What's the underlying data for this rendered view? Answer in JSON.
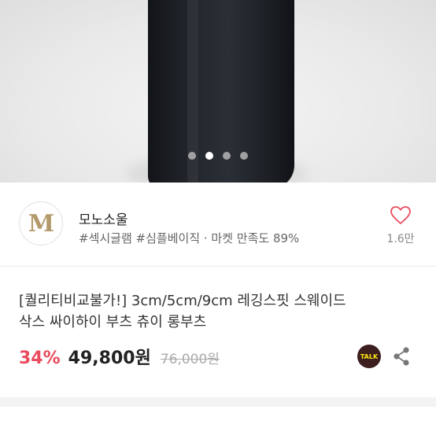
{
  "carousel": {
    "dot_count": 4,
    "active_index": 1
  },
  "store": {
    "logo_text": "M",
    "logo_color": "#b49a6b",
    "name": "모노소울",
    "tags": "#섹시글램 #심플베이직 · 마켓 만족도 89%",
    "likes": "1.6만"
  },
  "product": {
    "title_line1": "[퀄리티비교불가!] 3cm/5cm/9cm 레깅스핏 스웨이드",
    "title_line2": "삭스 싸이하이 부츠 츄이 롱부츠",
    "discount": "34%",
    "price": "49,800원",
    "original_price": "76,000원",
    "discount_color": "#e84c5e"
  },
  "actions": {
    "talk_label": "TALK",
    "talk_icon": "kakaotalk-icon",
    "share_icon": "share-icon",
    "like_icon": "heart-icon"
  }
}
